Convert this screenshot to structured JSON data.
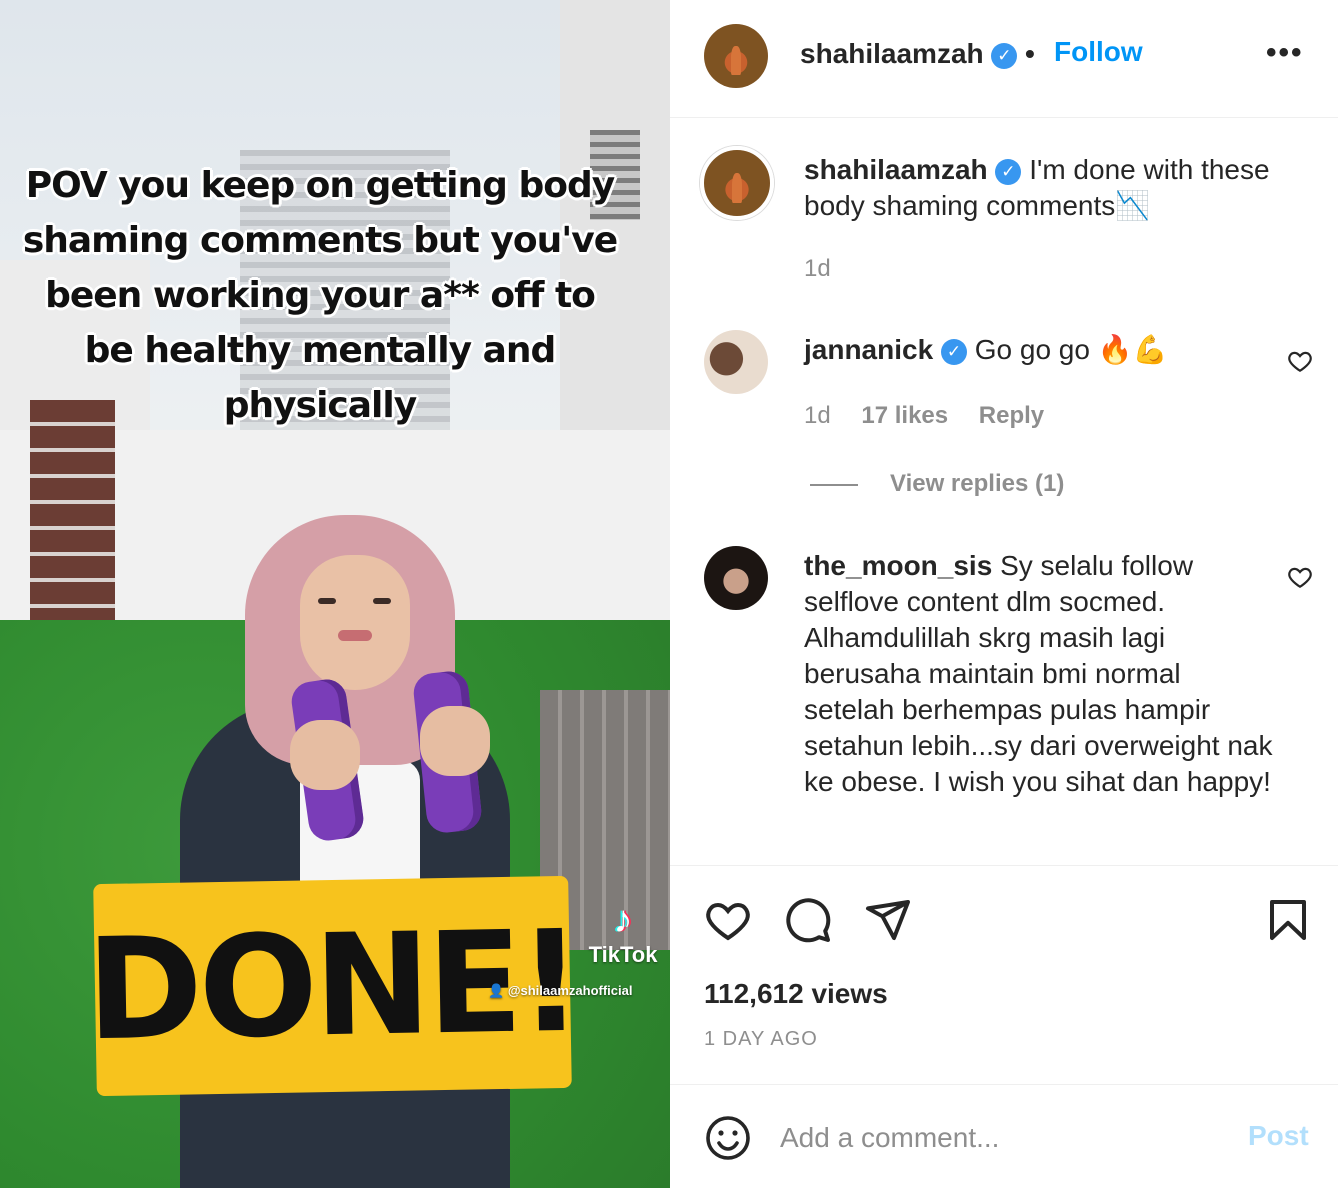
{
  "media": {
    "overlay_text": "POV you keep on getting body shaming comments but you've been working your a** off to be healthy mentally and physically",
    "sticker_text": "DONE!",
    "watermark_brand": "TikTok",
    "watermark_handle": "@shilaamzahofficial"
  },
  "header": {
    "username": "shahilaamzah",
    "separator": "•",
    "follow_label": "Follow",
    "more_label": "•••"
  },
  "caption": {
    "username": "shahilaamzah",
    "text": "I'm done with these body shaming comments📉",
    "time": "1d"
  },
  "comments": [
    {
      "username": "jannanick",
      "verified": true,
      "text": "Go go go 🔥💪",
      "time": "1d",
      "likes": "17 likes",
      "reply_label": "Reply",
      "view_replies": "View replies (1)"
    },
    {
      "username": "the_moon_sis",
      "verified": false,
      "text": "Sy selalu follow selflove content dlm socmed. Alhamdulillah skrg masih lagi berusaha maintain bmi normal setelah berhempas pulas hampir setahun lebih...sy dari overweight nak ke obese. I wish you sihat dan happy!"
    }
  ],
  "actions": {
    "like_icon": "heart-icon",
    "comment_icon": "comment-icon",
    "share_icon": "paper-plane-icon",
    "save_icon": "bookmark-icon"
  },
  "stats": {
    "views": "112,612 views",
    "date": "1 DAY AGO"
  },
  "composer": {
    "placeholder": "Add a comment...",
    "post_label": "Post"
  },
  "colors": {
    "link_blue": "#0095f6",
    "verified_blue": "#3897f0",
    "post_disabled": "#b2dffc",
    "muted_text": "#8e8e8e",
    "sticker_yellow": "#f7c31d"
  }
}
